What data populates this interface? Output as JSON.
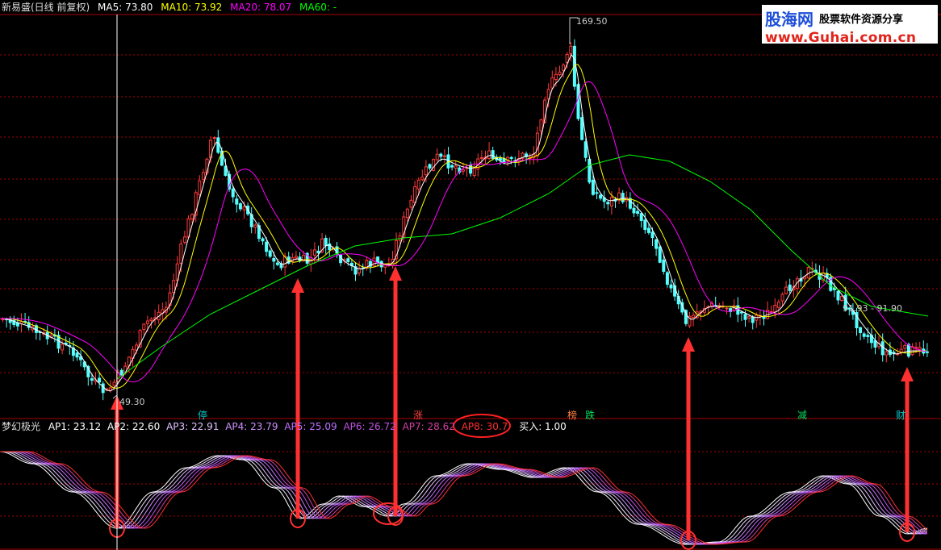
{
  "header": {
    "stock": "新易盛(日线 前复权)",
    "ma5": "MA5: 73.80",
    "ma10": "MA10: 73.92",
    "ma20": "MA20: 78.07",
    "ma60": "MA60: -"
  },
  "indicator": {
    "name": "梦幻极光",
    "ap1": "AP1: 23.12",
    "ap2": "AP2: 22.60",
    "ap3": "AP3: 22.91",
    "ap4": "AP4: 23.79",
    "ap5": "AP5: 25.09",
    "ap6": "AP6: 26.72",
    "ap7": "AP7: 28.62",
    "ap8": "AP8: 30.7",
    "buy": "买入: 1.00"
  },
  "annotations": {
    "max_price": "169.50",
    "min_price": "49.30",
    "last_price": "91.93 - 91.90"
  },
  "event_tags": [
    {
      "text": "停",
      "color": "#00c8c8"
    },
    {
      "text": "涨",
      "color": "#ff4040"
    },
    {
      "text": "榜",
      "color": "#ff8040"
    },
    {
      "text": "跌",
      "color": "#00e060"
    },
    {
      "text": "减",
      "color": "#00e060"
    },
    {
      "text": "财",
      "color": "#00c8c8"
    }
  ],
  "watermark": {
    "site": "股海网",
    "slogan": "股票软件资源分享",
    "url": "www.Guhai.com.cn"
  },
  "colors": {
    "up": "#ff3a3a",
    "down": "#54ffff",
    "ma5": "#ffffff",
    "ma10": "#ffff00",
    "ma20": "#ff00ff",
    "ma60": "#00ff00",
    "grid": "#aa0000",
    "arrow": "#ff3030"
  },
  "chart_data": {
    "type": "candlestick",
    "price_markers": {
      "max": 169.5,
      "min": 49.3
    },
    "buy_signal_count": 5,
    "indicator_series": [
      "AP1",
      "AP2",
      "AP3",
      "AP4",
      "AP5",
      "AP6",
      "AP7",
      "AP8"
    ]
  }
}
